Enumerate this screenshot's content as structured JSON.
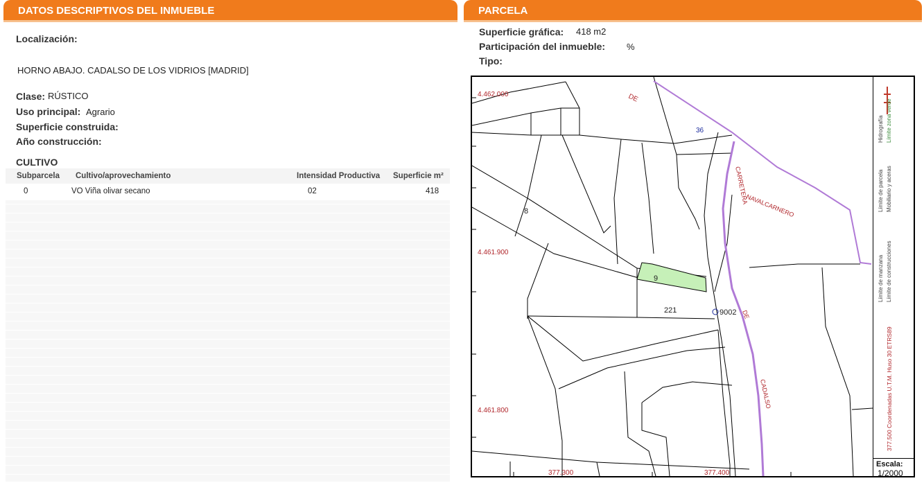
{
  "left_panel": {
    "title": "DATOS DESCRIPTIVOS DEL INMUEBLE",
    "localizacion_label": "Localización:",
    "localizacion_value": "HORNO ABAJO. CADALSO DE LOS VIDRIOS [MADRID]",
    "clase_label": "Clase:",
    "clase_value": "RÚSTICO",
    "uso_label": "Uso principal:",
    "uso_value": "Agrario",
    "superficie_label": "Superficie construida:",
    "superficie_value": "",
    "ano_label": "Año construcción:",
    "ano_value": ""
  },
  "cultivo": {
    "title": "CULTIVO",
    "headers": [
      "Subparcela",
      "Cultivo/aprovechamiento",
      "Intensidad Productiva",
      "Superficie m²"
    ],
    "rows": [
      [
        "0",
        "VO Viña olivar secano",
        "02",
        "418"
      ]
    ]
  },
  "right_panel": {
    "title": "PARCELA",
    "superficie_grafica_label": "Superficie gráfica:",
    "superficie_grafica_value": "418 m2",
    "participacion_label": "Participación del inmueble:",
    "participacion_value": "%",
    "tipo_label": "Tipo:",
    "tipo_value": ""
  },
  "map": {
    "coord_labels": {
      "y1": "4.462.000",
      "y2": "4.461.900",
      "y3": "4.461.800",
      "x1": "377.300",
      "x2": "377.400"
    },
    "road_labels": {
      "de_top": "DE",
      "carretera": "CARRETERA",
      "navalcarnero": "NAVALCARNERO",
      "de_mid": "DE",
      "cadalso": "CADALSO"
    },
    "parcel_labels": {
      "p36": "36",
      "p8": "8",
      "p9": "9",
      "p221": "221",
      "p9002": "9002"
    },
    "legend": {
      "hidrografia": "Hidrografía",
      "limite_zona_verde": "Límite zona verde",
      "limite_parcela": "Límite de parcela",
      "mobiliario": "Mobiliario y aceras",
      "limite_manzana": "Límite de manzana",
      "limite_construcciones": "Límite de construcciones",
      "coordenadas": "377.500 Coordenadas U.T.M. Huso 30 ETRS89"
    },
    "scale_label": "Escala:",
    "scale_value": "1/2000",
    "colors": {
      "road": "#b07ad6",
      "highlight": "#c6f0b8",
      "label_red": "#b0262b",
      "label_blue": "#1a2a9c"
    }
  }
}
